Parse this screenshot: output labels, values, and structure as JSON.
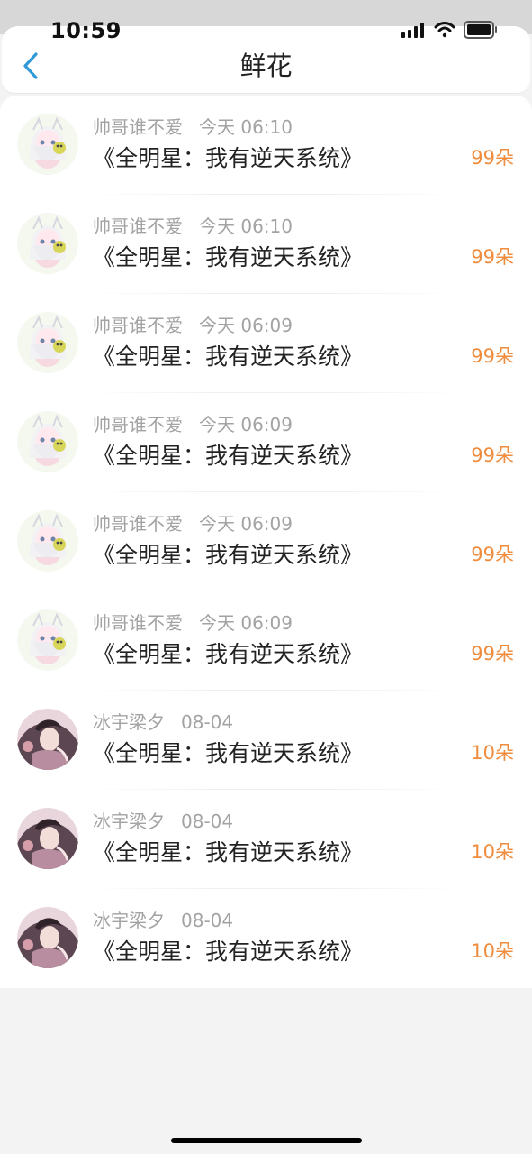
{
  "status": {
    "time": "10:59",
    "icons": [
      "signal-icon",
      "wifi-icon",
      "battery-icon"
    ]
  },
  "header": {
    "title": "鲜花"
  },
  "items": [
    {
      "name": "帅哥谁不爱",
      "time": "今天 06:10",
      "book": "《全明星：我有逆天系统》",
      "amount": "99朵",
      "avatar": "anime-white-hair"
    },
    {
      "name": "帅哥谁不爱",
      "time": "今天 06:10",
      "book": "《全明星：我有逆天系统》",
      "amount": "99朵",
      "avatar": "anime-white-hair"
    },
    {
      "name": "帅哥谁不爱",
      "time": "今天 06:09",
      "book": "《全明星：我有逆天系统》",
      "amount": "99朵",
      "avatar": "anime-white-hair"
    },
    {
      "name": "帅哥谁不爱",
      "time": "今天 06:09",
      "book": "《全明星：我有逆天系统》",
      "amount": "99朵",
      "avatar": "anime-white-hair"
    },
    {
      "name": "帅哥谁不爱",
      "time": "今天 06:09",
      "book": "《全明星：我有逆天系统》",
      "amount": "99朵",
      "avatar": "anime-white-hair"
    },
    {
      "name": "帅哥谁不爱",
      "time": "今天 06:09",
      "book": "《全明星：我有逆天系统》",
      "amount": "99朵",
      "avatar": "anime-white-hair"
    },
    {
      "name": "冰宇梁夕",
      "time": "08-04",
      "book": "《全明星：我有逆天系统》",
      "amount": "10朵",
      "avatar": "dark-hair-portrait"
    },
    {
      "name": "冰宇梁夕",
      "time": "08-04",
      "book": "《全明星：我有逆天系统》",
      "amount": "10朵",
      "avatar": "dark-hair-portrait"
    },
    {
      "name": "冰宇梁夕",
      "time": "08-04",
      "book": "《全明星：我有逆天系统》",
      "amount": "10朵",
      "avatar": "dark-hair-portrait"
    }
  ],
  "colors": {
    "accent": "#3299d8",
    "amount": "#ef8c3d",
    "meta": "#a3a3a3",
    "text": "#222222"
  }
}
